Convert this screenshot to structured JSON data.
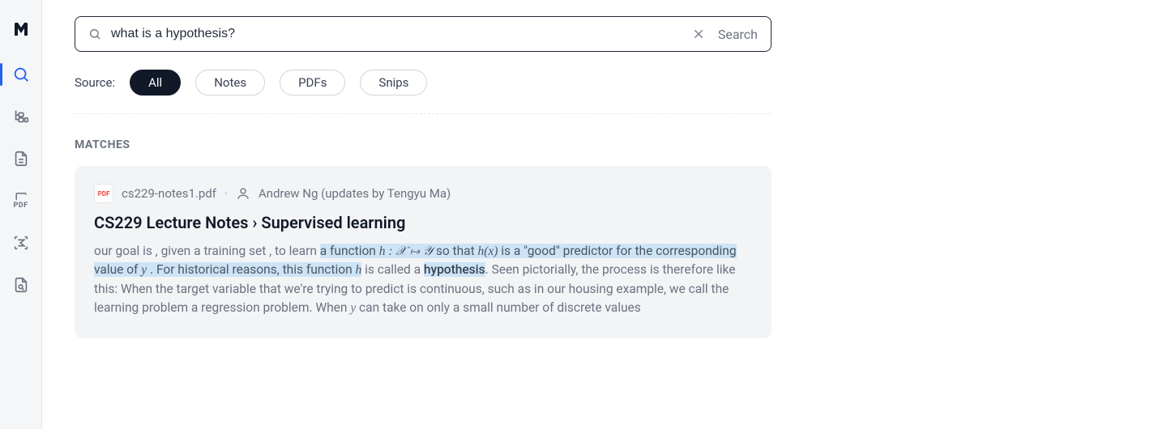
{
  "sidebar": {
    "logo": "M",
    "items": [
      {
        "id": "search",
        "name": "search-icon"
      },
      {
        "id": "tree",
        "name": "tree-icon"
      },
      {
        "id": "document",
        "name": "document-icon"
      },
      {
        "id": "pdf",
        "name": "pdf-icon",
        "label": "PDF"
      },
      {
        "id": "sigma",
        "name": "sigma-icon"
      },
      {
        "id": "image-search",
        "name": "image-search-icon"
      }
    ],
    "active": "search"
  },
  "search": {
    "value": "what is a hypothesis?",
    "clear_label": "Clear",
    "button_label": "Search"
  },
  "filters": {
    "label": "Source:",
    "options": [
      "All",
      "Notes",
      "PDFs",
      "Snips"
    ],
    "active": "All"
  },
  "section": {
    "header": "MATCHES"
  },
  "results": [
    {
      "file_badge": "PDF",
      "file_name": "cs229-notes1.pdf",
      "author": "Andrew Ng (updates by Tengyu Ma)",
      "title": "CS229 Lecture Notes › Supervised learning",
      "excerpt": {
        "pre": "our goal is , given a training set , to learn ",
        "hl1": "a function ",
        "math1": "h : 𝒳 ↦ 𝒴",
        "hl2": " so that ",
        "math2": "h(x)",
        "hl3": " is a \"good\" predictor for the corresponding value of ",
        "math3": "y",
        "hl4": " . For historical reasons, this function ",
        "math4": "h",
        "mid": " is called a ",
        "term": "hypothesis",
        "post1": ". Seen pictorially, the process is therefore like this: When the target variable that we're trying to predict is continuous, such as in our housing example, we call the learning problem a regression problem. When ",
        "math5": "y",
        "post2": " can take on only a small number of discrete values"
      }
    }
  ]
}
